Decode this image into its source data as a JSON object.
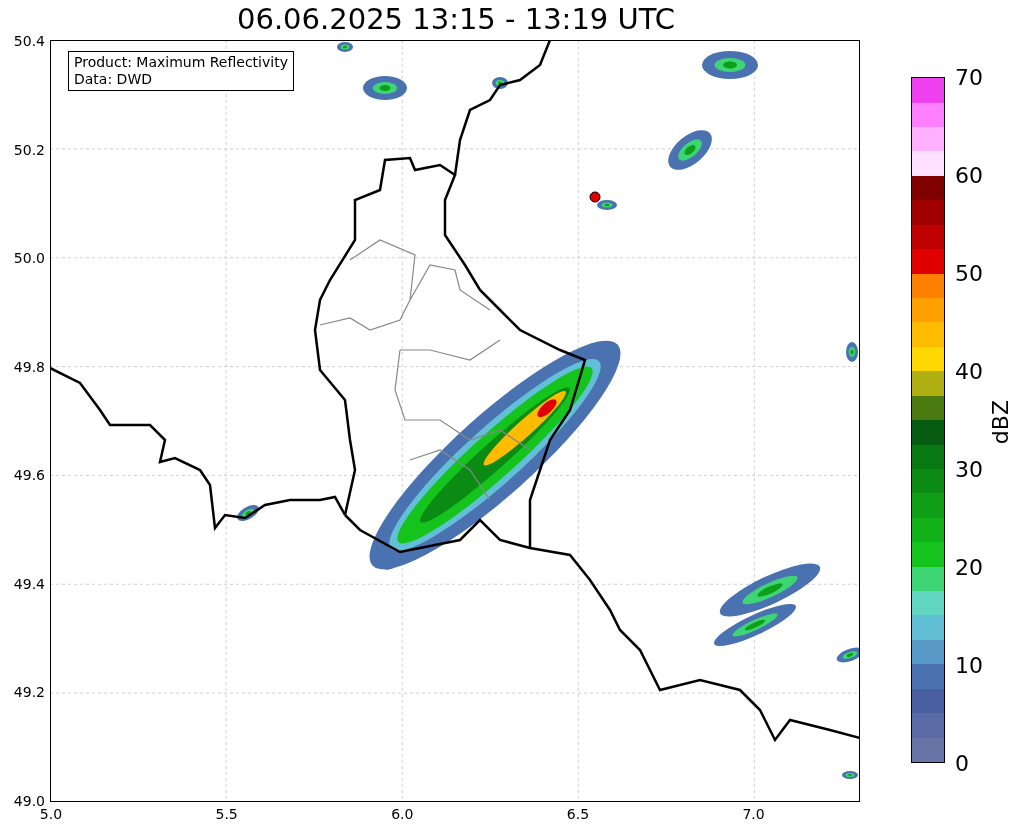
{
  "title": "06.06.2025 13:15 - 13:19 UTC",
  "info_box": {
    "lines": [
      "Product: Maximum Reflectivity",
      "Data: DWD"
    ]
  },
  "map": {
    "y_ticks": [
      "50.4",
      "50.2",
      "50.0",
      "49.8",
      "49.6",
      "49.4",
      "49.2",
      "49.0"
    ],
    "x_ticks": [
      "5.0",
      "5.5",
      "6.0",
      "6.5",
      "7.0"
    ]
  },
  "colorbar": {
    "label": "dBZ",
    "ticks": [
      "70",
      "60",
      "50",
      "40",
      "30",
      "20",
      "10",
      "0"
    ],
    "bins": [
      {
        "color": "#6674a6"
      },
      {
        "color": "#5a6aa6"
      },
      {
        "color": "#4a5fa0"
      },
      {
        "color": "#4a72b0"
      },
      {
        "color": "#5a9ac8"
      },
      {
        "color": "#62bfd5"
      },
      {
        "color": "#60d6c0"
      },
      {
        "color": "#3ed577"
      },
      {
        "color": "#14c41c"
      },
      {
        "color": "#12b11a"
      },
      {
        "color": "#0e9f16"
      },
      {
        "color": "#0b8b13"
      },
      {
        "color": "#097a12"
      },
      {
        "color": "#065d12"
      },
      {
        "color": "#4a7a10"
      },
      {
        "color": "#b0b014"
      },
      {
        "color": "#ffd700"
      },
      {
        "color": "#ffbb00"
      },
      {
        "color": "#ffa000"
      },
      {
        "color": "#ff8000"
      },
      {
        "color": "#e00000"
      },
      {
        "color": "#c00000"
      },
      {
        "color": "#a00000"
      },
      {
        "color": "#800000"
      },
      {
        "color": "#ffe0ff"
      },
      {
        "color": "#ffb0ff"
      },
      {
        "color": "#ff80ff"
      },
      {
        "color": "#ee40ee"
      }
    ]
  }
}
